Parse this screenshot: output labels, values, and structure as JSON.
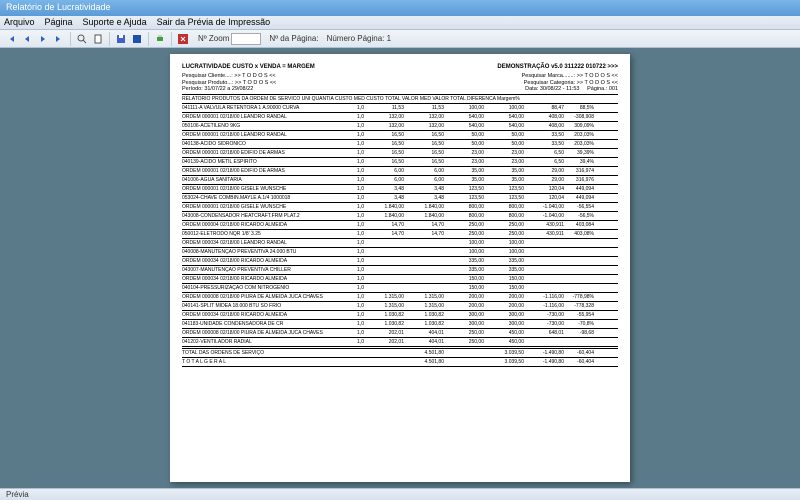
{
  "window": {
    "title": "Relatório de Lucratividade"
  },
  "menu": {
    "arquivo": "Arquivo",
    "pagina": "Página",
    "suporte": "Suporte e Ajuda",
    "sair": "Sair da Prévia de Impressão"
  },
  "toolbar": {
    "zoom_label": "Nº Zoom",
    "zoom_value": "",
    "page_label": "Nº da Página:",
    "page_value": "Número Página: 1"
  },
  "status": {
    "text": "Prévia"
  },
  "report": {
    "title_left": "LUCRATIVIDADE  CUSTO x VENDA = MARGEM",
    "title_right": "DEMONSTRAÇÃO v5.0 311222 010722 >>>",
    "filt_cliente": "Pesquisar Cliente....: >> T O D O S <<",
    "filt_marca": "Pesquisar Marca.......: >> T O D O S <<",
    "filt_produto": "Pesquisar Produto...: >> T O D O S <<",
    "filt_categoria": "Pesquisar Categoria: >> T O D O S <<",
    "periodo": "Período: 31/07/22 a 29/08/22",
    "data": "Data: 30/08/22 - 11:53",
    "pagina": "Página.: 001",
    "col_header": "RELATORIO PRODUTOS DA ORDEM DE SERVICO    UNI QUANTIA CUSTO MED  CUSTO TOTAL VALOR MED   VALOR TOTAL DIFERENCA Margem%",
    "rows": [
      {
        "d": "041111-A VALVULA RETENTORA 1 A.90000 CURVA",
        "u": "1,0",
        "q": "11,53",
        "cm": "11,53",
        "ct": "100,00",
        "vm": "100,00",
        "dif": "88,47",
        "mg": "88,5%"
      },
      {
        "d": "ORDEM  000001 02/18/00  LEANDRO RANDAL",
        "u": "1,0",
        "q": "132,00",
        "cm": "132,00",
        "ct": "540,00",
        "vm": "540,00",
        "dif": "408,00",
        "mg": "-308,908"
      },
      {
        "d": "050106-ACETILENO 9KG",
        "u": "1,0",
        "q": "132,00",
        "cm": "132,00",
        "ct": "540,00",
        "vm": "540,00",
        "dif": "408,00",
        "mg": "309,09%"
      },
      {
        "d": "ORDEM  000001 02/18/00  LEANDRO RANDAL",
        "u": "1,0",
        "q": "16,50",
        "cm": "16,50",
        "ct": "50,00",
        "vm": "50,00",
        "dif": "33,50",
        "mg": "203,03%"
      },
      {
        "d": "040138-ACIDO SIDRONICO",
        "u": "1,0",
        "q": "16,50",
        "cm": "16,50",
        "ct": "50,00",
        "vm": "50,00",
        "dif": "33,50",
        "mg": "203,03%"
      },
      {
        "d": "ORDEM  000001 02/18/00  EDIFIO DE ARMAS",
        "u": "1,0",
        "q": "16,50",
        "cm": "16,50",
        "ct": "23,00",
        "vm": "23,00",
        "dif": "6,50",
        "mg": "39,39%"
      },
      {
        "d": "040139-ACIDO METIL ESPIRITO",
        "u": "1,0",
        "q": "16,50",
        "cm": "16,50",
        "ct": "23,00",
        "vm": "23,00",
        "dif": "6,50",
        "mg": "39,4%"
      },
      {
        "d": "ORDEM  000001 02/18/00  EDIFIO DE ARMAS",
        "u": "1,0",
        "q": "6,00",
        "cm": "6,00",
        "ct": "35,00",
        "vm": "35,00",
        "dif": "29,00",
        "mg": "316,974"
      },
      {
        "d": "041006-AGUA SANITARIA",
        "u": "1,0",
        "q": "6,00",
        "cm": "6,00",
        "ct": "35,00",
        "vm": "35,00",
        "dif": "29,00",
        "mg": "316,976"
      },
      {
        "d": "ORDEM  000001 02/18/00  GISELE WUNSCHE",
        "u": "1,0",
        "q": "3,48",
        "cm": "3,48",
        "ct": "123,50",
        "vm": "123,50",
        "dif": "120,04",
        "mg": "449,094"
      },
      {
        "d": "053024-CHAVE COMBIN.MAYLE A.1/4 1000018",
        "u": "1,0",
        "q": "3,48",
        "cm": "3,48",
        "ct": "123,50",
        "vm": "123,50",
        "dif": "120,04",
        "mg": "449,094"
      },
      {
        "d": "ORDEM  000001 02/18/00  GISELE WUNSCHE",
        "u": "1,0",
        "q": "1.840,00",
        "cm": "1.840,00",
        "ct": "800,00",
        "vm": "800,00",
        "dif": "-1.040,00",
        "mg": "-56,554"
      },
      {
        "d": "043008-CONDENSADOR HEATCRAFT.FRM PLAT.2",
        "u": "1,0",
        "q": "1.840,00",
        "cm": "1.840,00",
        "ct": "800,00",
        "vm": "800,00",
        "dif": "-1.040,00",
        "mg": "-56,5%"
      },
      {
        "d": "ORDEM  000004 02/18/00  RICARDO ALMEIDA",
        "u": "1,0",
        "q": "14,70",
        "cm": "14,70",
        "ct": "250,00",
        "vm": "250,00",
        "dif": "430,911",
        "mg": "403,084"
      },
      {
        "d": "050012-ELETRODO NQR 1/8'  3.25",
        "u": "1,0",
        "q": "14,70",
        "cm": "14,70",
        "ct": "250,00",
        "vm": "250,00",
        "dif": "430,911",
        "mg": "403,08%"
      },
      {
        "d": "ORDEM  000034 02/18/00  LEANDRO RANDAL",
        "u": "1,0",
        "q": "",
        "cm": "",
        "ct": "100,00",
        "vm": "100,00",
        "dif": "",
        "mg": ""
      },
      {
        "d": "040008-MANUTENÇÃO PREVENTIVA 24.000 BTU",
        "u": "1,0",
        "q": "",
        "cm": "",
        "ct": "100,00",
        "vm": "100,00",
        "dif": "",
        "mg": ""
      },
      {
        "d": "ORDEM  000034 02/18/00  RICARDO ALMEIDA",
        "u": "1,0",
        "q": "",
        "cm": "",
        "ct": "335,00",
        "vm": "335,00",
        "dif": "",
        "mg": ""
      },
      {
        "d": "043007-MANUTENÇÃO PREVENTIVA CHILLER",
        "u": "1,0",
        "q": "",
        "cm": "",
        "ct": "335,00",
        "vm": "335,00",
        "dif": "",
        "mg": ""
      },
      {
        "d": "ORDEM  000034 02/18/00  RICARDO ALMEIDA",
        "u": "1,0",
        "q": "",
        "cm": "",
        "ct": "150,00",
        "vm": "150,00",
        "dif": "",
        "mg": ""
      },
      {
        "d": "040104-PRESSURIZAÇÃO COM NITROGÊNIO",
        "u": "1,0",
        "q": "",
        "cm": "",
        "ct": "150,00",
        "vm": "150,00",
        "dif": "",
        "mg": ""
      },
      {
        "d": "ORDEM  000008 02/18/00  PIURA DE ALMEIDA JUCA CHAVES",
        "u": "1,0",
        "q": "1.315,00",
        "cm": "1.315,00",
        "ct": "200,00",
        "vm": "200,00",
        "dif": "-1.116,00",
        "mg": "-778,98%"
      },
      {
        "d": "040141-SPLIT MIDEA 18.000 BTU SÓ FRIO",
        "u": "1,0",
        "q": "1.315,00",
        "cm": "1.315,00",
        "ct": "200,00",
        "vm": "200,00",
        "dif": "-1.116,00",
        "mg": "-778,328"
      },
      {
        "d": "ORDEM  000034 02/18/00  RICARDO ALMEIDA",
        "u": "1,0",
        "q": "1.030,82",
        "cm": "1.030,82",
        "ct": "300,00",
        "vm": "300,00",
        "dif": "-730,00",
        "mg": "-55,954"
      },
      {
        "d": "041183-UNIDADE CONDENSADORA DE CR",
        "u": "1,0",
        "q": "1.030,82",
        "cm": "1.030,82",
        "ct": "300,00",
        "vm": "300,00",
        "dif": "-730,00",
        "mg": "-70,8%"
      },
      {
        "d": "ORDEM  000008 02/18/00  PIURA DE ALMEIDA JUCA CHAVES",
        "u": "1,0",
        "q": "202,01",
        "cm": "404,01",
        "ct": "250,00",
        "vm": "450,00",
        "dif": "648,01",
        "mg": "-98,68"
      },
      {
        "d": "041202-VENTILADOR RADIAL",
        "u": "1,0",
        "q": "202,01",
        "cm": "404,01",
        "ct": "250,00",
        "vm": "450,00",
        "dif": "",
        "mg": ""
      }
    ],
    "tot_ordens": "TOTAL DAS ORDENS DE SERVIÇO",
    "tot_geral": "T O T A L   G E R A L",
    "tot_q": "4.501,80",
    "tot_v": "3.039,50",
    "tot_d": "-1.490,80",
    "tot_m": "-60,404"
  }
}
